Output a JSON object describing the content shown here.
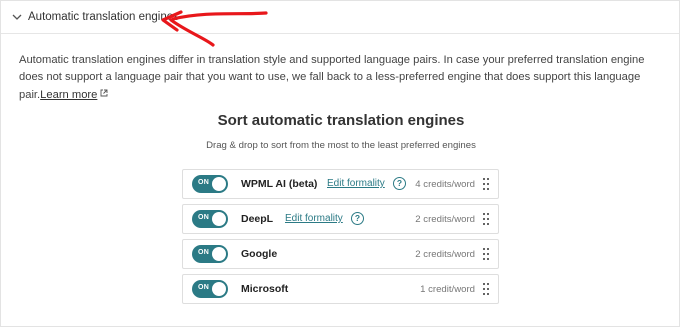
{
  "section": {
    "title": "Automatic translation engines"
  },
  "description": {
    "text": "Automatic translation engines differ in translation style and supported language pairs. In case your preferred translation engine does not support a language pair that you want to use, we fall back to a less-preferred engine that does support this language pair.",
    "learn_more": "Learn more"
  },
  "sort": {
    "title": "Sort automatic translation engines",
    "subtitle": "Drag & drop to sort from the most to the least preferred engines"
  },
  "engines": [
    {
      "toggle": "ON",
      "name": "WPML AI (beta)",
      "edit": "Edit formality",
      "help": "?",
      "credits": "4 credits/word"
    },
    {
      "toggle": "ON",
      "name": "DeepL",
      "edit": "Edit formality",
      "help": "?",
      "credits": "2 credits/word"
    },
    {
      "toggle": "ON",
      "name": "Google",
      "credits": "2 credits/word"
    },
    {
      "toggle": "ON",
      "name": "Microsoft",
      "credits": "1 credit/word"
    }
  ],
  "colors": {
    "accent": "#2b7a85",
    "annotation": "#e8171b"
  },
  "icons": {
    "collapse": "chevron-down-icon",
    "external": "external-link-icon",
    "help": "help-icon",
    "drag": "drag-handle-icon",
    "annotation": "red-arrow-annotation"
  }
}
